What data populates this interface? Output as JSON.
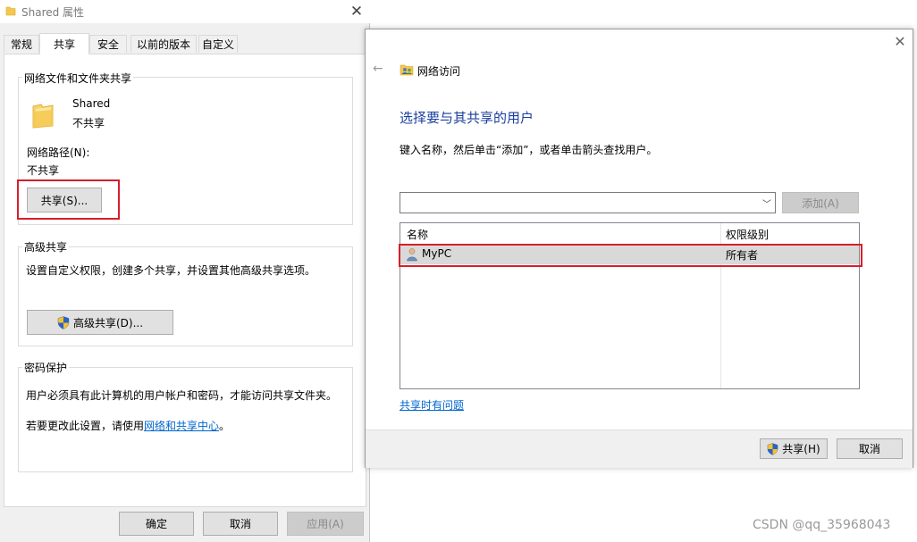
{
  "properties_dialog": {
    "title": "Shared 属性",
    "tabs": [
      {
        "label": "常规"
      },
      {
        "label": "共享"
      },
      {
        "label": "安全"
      },
      {
        "label": "以前的版本"
      },
      {
        "label": "自定义"
      }
    ],
    "network_sharing": {
      "group_label": "网络文件和文件夹共享",
      "folder_name": "Shared",
      "folder_status": "不共享",
      "path_label": "网络路径(N):",
      "path_value": "不共享",
      "share_button": "共享(S)..."
    },
    "advanced_sharing": {
      "group_label": "高级共享",
      "description": "设置自定义权限，创建多个共享，并设置其他高级共享选项。",
      "button": "高级共享(D)..."
    },
    "password_protection": {
      "group_label": "密码保护",
      "description": "用户必须具有此计算机的用户帐户和密码，才能访问共享文件夹。",
      "change_prefix": "若要更改此设置，请使用",
      "link": "网络和共享中心",
      "change_suffix": "。"
    },
    "buttons": {
      "ok": "确定",
      "cancel": "取消",
      "apply": "应用(A)"
    }
  },
  "network_access_dialog": {
    "title": "网络访问",
    "heading": "选择要与其共享的用户",
    "instruction": "键入名称，然后单击“添加”，或者单击箭头查找用户。",
    "name_input_value": "",
    "add_button": "添加(A)",
    "columns": {
      "name": "名称",
      "permission": "权限级别"
    },
    "rows": [
      {
        "name": "MyPC",
        "permission": "所有者"
      }
    ],
    "help_link": "共享时有问题",
    "share_button": "共享(H)",
    "cancel_button": "取消"
  },
  "watermark": "CSDN @qq_35968043",
  "colors": {
    "accent_heading": "#1a3e9e",
    "link": "#0066cc",
    "highlight_box": "#d81e2a",
    "selected_row": "#d9d9d9"
  }
}
